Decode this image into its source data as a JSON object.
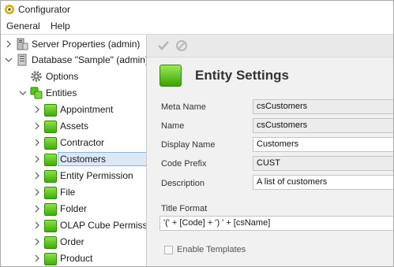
{
  "window": {
    "title": "Configurator"
  },
  "menu": [
    "General",
    "Help"
  ],
  "tree": {
    "items": [
      {
        "label": "Server Properties (admin)",
        "icon": "server-icon"
      },
      {
        "label": "Database \"Sample\" (admin)",
        "icon": "database-icon"
      },
      {
        "label": "Options",
        "icon": "gear-icon"
      },
      {
        "label": "Entities",
        "icon": "entities-icon"
      },
      {
        "label": "Appointment",
        "icon": "entity-icon"
      },
      {
        "label": "Assets",
        "icon": "entity-icon"
      },
      {
        "label": "Contractor",
        "icon": "entity-icon"
      },
      {
        "label": "Customers",
        "icon": "entity-icon",
        "selected": true
      },
      {
        "label": "Entity Permission",
        "icon": "entity-icon"
      },
      {
        "label": "File",
        "icon": "entity-icon"
      },
      {
        "label": "Folder",
        "icon": "entity-icon"
      },
      {
        "label": "OLAP Cube Permission",
        "icon": "entity-icon"
      },
      {
        "label": "Order",
        "icon": "entity-icon"
      },
      {
        "label": "Product",
        "icon": "entity-icon"
      }
    ]
  },
  "toolbar": {
    "save_icon": "checkmark-icon",
    "cancel_icon": "cancel-icon"
  },
  "settings": {
    "title": "Entity Settings",
    "fields": {
      "meta_name": {
        "label": "Meta Name",
        "value": "csCustomers"
      },
      "name": {
        "label": "Name",
        "value": "csCustomers"
      },
      "display_name": {
        "label": "Display Name",
        "value": "Customers"
      },
      "code_prefix": {
        "label": "Code Prefix",
        "value": "CUST"
      },
      "description": {
        "label": "Description",
        "value": "A list of customers"
      }
    },
    "title_format": {
      "label": "Title Format",
      "value": "'(' + [Code] + ') ' + [csName]"
    },
    "enable_templates": {
      "label": "Enable Templates",
      "checked": false
    }
  },
  "colors": {
    "accent_green": "#3fae00",
    "selection": "#dce8f6"
  }
}
